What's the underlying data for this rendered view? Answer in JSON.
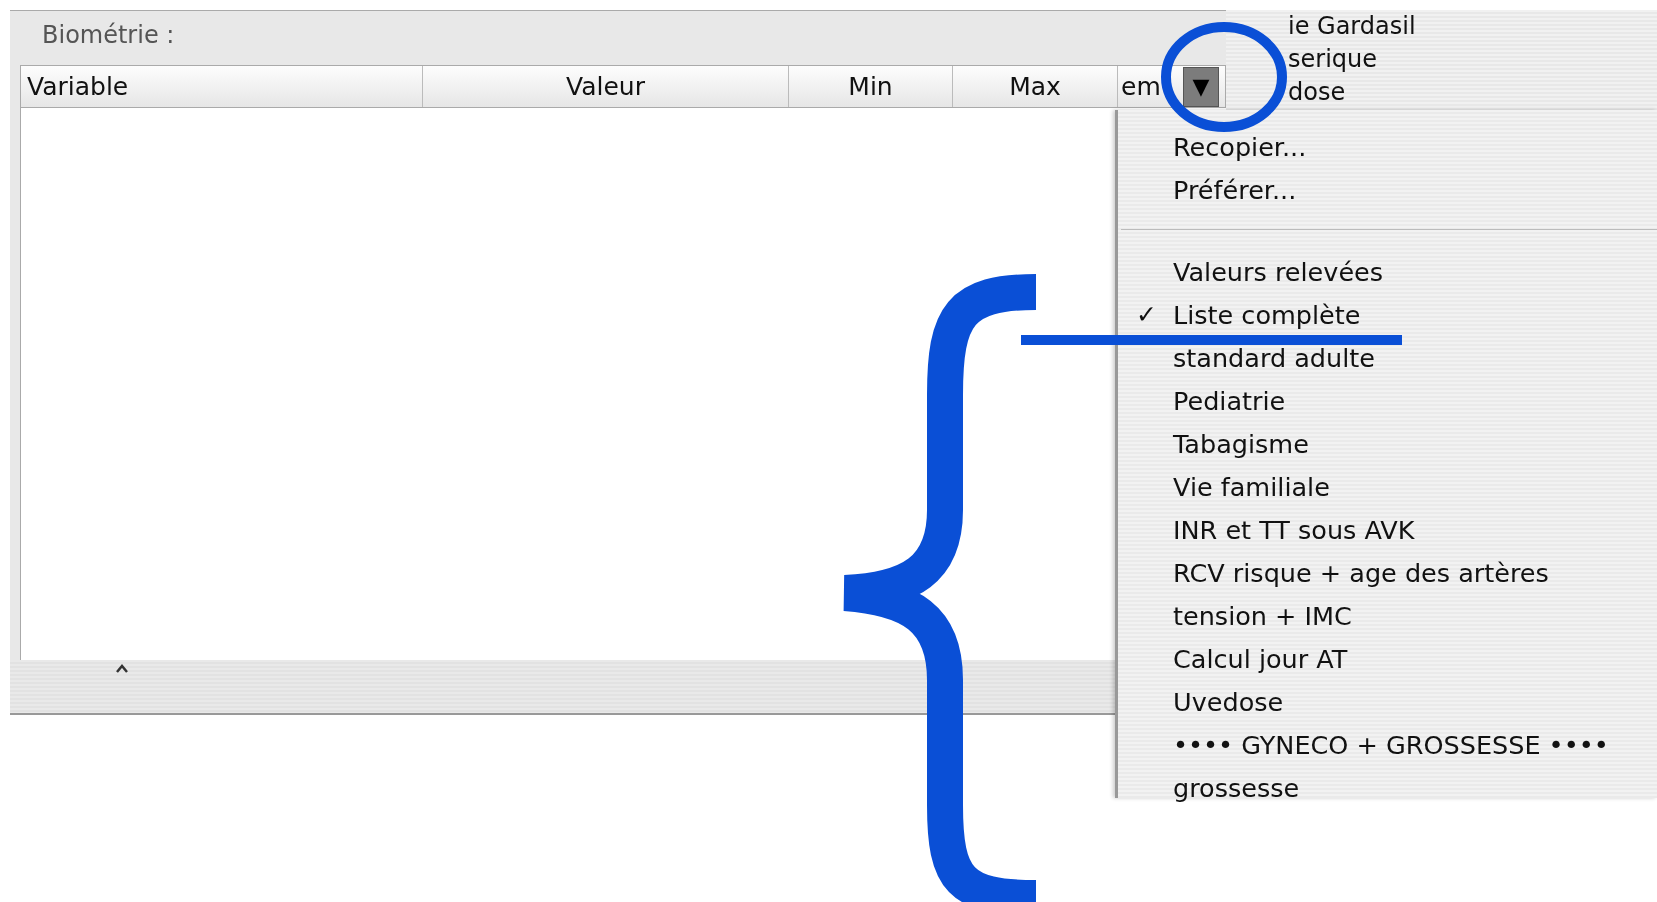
{
  "panel": {
    "title": "Biométrie :"
  },
  "table": {
    "columns": [
      {
        "label": "Variable"
      },
      {
        "label": "Valeur"
      },
      {
        "label": "Min"
      },
      {
        "label": "Max"
      },
      {
        "label": "em",
        "menu_button": "▼"
      }
    ]
  },
  "background_window": {
    "items": [
      "ie Gardasil",
      "serique",
      "dose"
    ]
  },
  "menu": {
    "check_mark": "✓",
    "items": [
      {
        "kind": "item",
        "label": "Recopier...",
        "checked": false
      },
      {
        "kind": "item",
        "label": "Préférer...",
        "checked": false
      },
      {
        "kind": "separator"
      },
      {
        "kind": "item",
        "label": "Valeurs relevées",
        "checked": false
      },
      {
        "kind": "item",
        "label": "Liste complète",
        "checked": true
      },
      {
        "kind": "item",
        "label": "standard adulte",
        "checked": false
      },
      {
        "kind": "item",
        "label": "Pediatrie",
        "checked": false
      },
      {
        "kind": "item",
        "label": "Tabagisme",
        "checked": false
      },
      {
        "kind": "item",
        "label": "Vie familiale",
        "checked": false
      },
      {
        "kind": "item",
        "label": "INR et TT sous AVK",
        "checked": false
      },
      {
        "kind": "item",
        "label": "RCV risque + age des artères",
        "checked": false
      },
      {
        "kind": "item",
        "label": "tension + IMC",
        "checked": false
      },
      {
        "kind": "item",
        "label": "Calcul jour AT",
        "checked": false
      },
      {
        "kind": "item",
        "label": "Uvedose",
        "checked": false
      },
      {
        "kind": "item",
        "label": "•••• GYNECO + GROSSESSE ••••",
        "checked": false
      },
      {
        "kind": "item",
        "label": "grossesse",
        "checked": false
      }
    ]
  },
  "annotations": [
    {
      "kind": "circle"
    },
    {
      "kind": "underline"
    },
    {
      "kind": "brace"
    }
  ]
}
